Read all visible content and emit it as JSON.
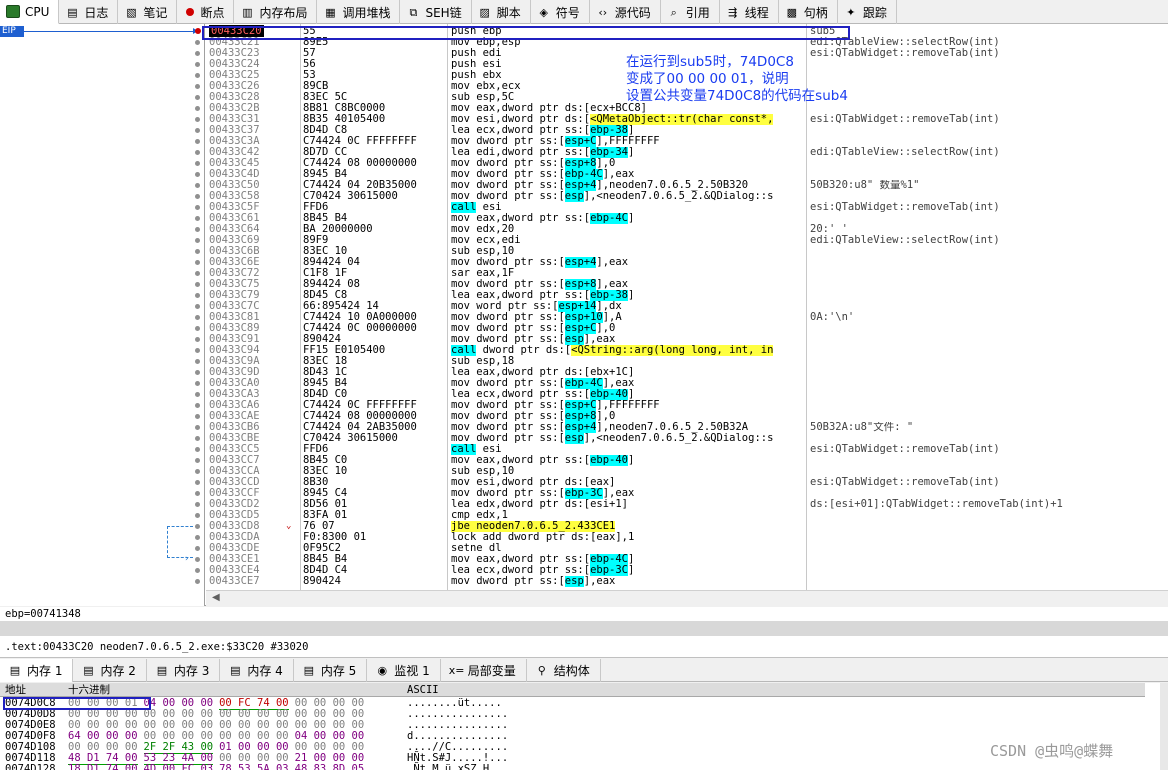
{
  "top_tabs": [
    {
      "icon": "cpu-icon",
      "label": "CPU"
    },
    {
      "icon": "log-icon",
      "label": "日志"
    },
    {
      "icon": "notes-icon",
      "label": "笔记"
    },
    {
      "icon": "breakpoint-icon",
      "label": "断点"
    },
    {
      "icon": "memory-map-icon",
      "label": "内存布局"
    },
    {
      "icon": "callstack-icon",
      "label": "调用堆栈"
    },
    {
      "icon": "seh-icon",
      "label": "SEH链"
    },
    {
      "icon": "script-icon",
      "label": "脚本"
    },
    {
      "icon": "symbols-icon",
      "label": "符号"
    },
    {
      "icon": "source-icon",
      "label": "源代码"
    },
    {
      "icon": "references-icon",
      "label": "引用"
    },
    {
      "icon": "threads-icon",
      "label": "线程"
    },
    {
      "icon": "handles-icon",
      "label": "句柄"
    },
    {
      "icon": "trace-icon",
      "label": "跟踪"
    }
  ],
  "eip_label": "EIP",
  "annotation": [
    "在运行到sub5时，74D0C8",
    "变成了00 00 00 01，说明",
    "设置公共变量74D0C8的代码在sub4"
  ],
  "dis_rows": [
    {
      "addr": "00433C20",
      "bytes": "55",
      "instr": "push ebp",
      "cmt": "sub5"
    },
    {
      "addr": "00433C21",
      "bytes": "89E5",
      "instr": "mov ebp,esp",
      "cmt": "edi:QTableView::selectRow(int)"
    },
    {
      "addr": "00433C23",
      "bytes": "57",
      "instr": "push edi",
      "cmt": "esi:QTabWidget::removeTab(int)"
    },
    {
      "addr": "00433C24",
      "bytes": "56",
      "instr": "push esi",
      "cmt": ""
    },
    {
      "addr": "00433C25",
      "bytes": "53",
      "instr": "push ebx",
      "cmt": ""
    },
    {
      "addr": "00433C26",
      "bytes": "89CB",
      "instr": "mov ebx,ecx",
      "cmt": ""
    },
    {
      "addr": "00433C28",
      "bytes": "83EC 5C",
      "instr": "sub esp,5C",
      "cmt": ""
    },
    {
      "addr": "00433C2B",
      "bytes": "8B81 C8BC0000",
      "instr": "mov eax,dword ptr ds:[ecx+BCC8]",
      "cmt": ""
    },
    {
      "addr": "00433C31",
      "bytes": "8B35 40105400",
      "instr": "mov esi,dword ptr ds:[<QMetaObject::tr(char const*,",
      "cmt": "esi:QTabWidget::removeTab(int)"
    },
    {
      "addr": "00433C37",
      "bytes": "8D4D C8",
      "instr": "lea ecx,dword ptr ss:[ebp-38]",
      "cmt": ""
    },
    {
      "addr": "00433C3A",
      "bytes": "C74424 0C FFFFFFFF",
      "instr": "mov dword ptr ss:[esp+C],FFFFFFFF",
      "cmt": ""
    },
    {
      "addr": "00433C42",
      "bytes": "8D7D CC",
      "instr": "lea edi,dword ptr ss:[ebp-34]",
      "cmt": "edi:QTableView::selectRow(int)"
    },
    {
      "addr": "00433C45",
      "bytes": "C74424 08 00000000",
      "instr": "mov dword ptr ss:[esp+8],0",
      "cmt": ""
    },
    {
      "addr": "00433C4D",
      "bytes": "8945 B4",
      "instr": "mov dword ptr ss:[ebp-4C],eax",
      "cmt": ""
    },
    {
      "addr": "00433C50",
      "bytes": "C74424 04 20B35000",
      "instr": "mov dword ptr ss:[esp+4],neoden7.0.6.5_2.50B320",
      "cmt": "50B320:u8\" 数量%1\""
    },
    {
      "addr": "00433C58",
      "bytes": "C70424 30615000",
      "instr": "mov dword ptr ss:[esp],<neoden7.0.6.5_2.&QDialog::s",
      "cmt": ""
    },
    {
      "addr": "00433C5F",
      "bytes": "FFD6",
      "instr": "call esi",
      "cmt": "esi:QTabWidget::removeTab(int)"
    },
    {
      "addr": "00433C61",
      "bytes": "8B45 B4",
      "instr": "mov eax,dword ptr ss:[ebp-4C]",
      "cmt": ""
    },
    {
      "addr": "00433C64",
      "bytes": "BA 20000000",
      "instr": "mov edx,20",
      "cmt": "20:' '"
    },
    {
      "addr": "00433C69",
      "bytes": "89F9",
      "instr": "mov ecx,edi",
      "cmt": "edi:QTableView::selectRow(int)"
    },
    {
      "addr": "00433C6B",
      "bytes": "83EC 10",
      "instr": "sub esp,10",
      "cmt": ""
    },
    {
      "addr": "00433C6E",
      "bytes": "894424 04",
      "instr": "mov dword ptr ss:[esp+4],eax",
      "cmt": ""
    },
    {
      "addr": "00433C72",
      "bytes": "C1F8 1F",
      "instr": "sar eax,1F",
      "cmt": ""
    },
    {
      "addr": "00433C75",
      "bytes": "894424 08",
      "instr": "mov dword ptr ss:[esp+8],eax",
      "cmt": ""
    },
    {
      "addr": "00433C79",
      "bytes": "8D45 C8",
      "instr": "lea eax,dword ptr ss:[ebp-38]",
      "cmt": ""
    },
    {
      "addr": "00433C7C",
      "bytes": "66:895424 14",
      "instr": "mov word ptr ss:[esp+14],dx",
      "cmt": ""
    },
    {
      "addr": "00433C81",
      "bytes": "C74424 10 0A000000",
      "instr": "mov dword ptr ss:[esp+10],A",
      "cmt": "0A:'\\n'"
    },
    {
      "addr": "00433C89",
      "bytes": "C74424 0C 00000000",
      "instr": "mov dword ptr ss:[esp+C],0",
      "cmt": ""
    },
    {
      "addr": "00433C91",
      "bytes": "890424",
      "instr": "mov dword ptr ss:[esp],eax",
      "cmt": ""
    },
    {
      "addr": "00433C94",
      "bytes": "FF15 E0105400",
      "instr": "call dword ptr ds:[<QString::arg(long long, int, in",
      "cmt": ""
    },
    {
      "addr": "00433C9A",
      "bytes": "83EC 18",
      "instr": "sub esp,18",
      "cmt": ""
    },
    {
      "addr": "00433C9D",
      "bytes": "8D43 1C",
      "instr": "lea eax,dword ptr ds:[ebx+1C]",
      "cmt": ""
    },
    {
      "addr": "00433CA0",
      "bytes": "8945 B4",
      "instr": "mov dword ptr ss:[ebp-4C],eax",
      "cmt": ""
    },
    {
      "addr": "00433CA3",
      "bytes": "8D4D C0",
      "instr": "lea ecx,dword ptr ss:[ebp-40]",
      "cmt": ""
    },
    {
      "addr": "00433CA6",
      "bytes": "C74424 0C FFFFFFFF",
      "instr": "mov dword ptr ss:[esp+C],FFFFFFFF",
      "cmt": ""
    },
    {
      "addr": "00433CAE",
      "bytes": "C74424 08 00000000",
      "instr": "mov dword ptr ss:[esp+8],0",
      "cmt": ""
    },
    {
      "addr": "00433CB6",
      "bytes": "C74424 04 2AB35000",
      "instr": "mov dword ptr ss:[esp+4],neoden7.0.6.5_2.50B32A",
      "cmt": "50B32A:u8\"文件: \""
    },
    {
      "addr": "00433CBE",
      "bytes": "C70424 30615000",
      "instr": "mov dword ptr ss:[esp],<neoden7.0.6.5_2.&QDialog::s",
      "cmt": ""
    },
    {
      "addr": "00433CC5",
      "bytes": "FFD6",
      "instr": "call esi",
      "cmt": "esi:QTabWidget::removeTab(int)"
    },
    {
      "addr": "00433CC7",
      "bytes": "8B45 C0",
      "instr": "mov eax,dword ptr ss:[ebp-40]",
      "cmt": ""
    },
    {
      "addr": "00433CCA",
      "bytes": "83EC 10",
      "instr": "sub esp,10",
      "cmt": ""
    },
    {
      "addr": "00433CCD",
      "bytes": "8B30",
      "instr": "mov esi,dword ptr ds:[eax]",
      "cmt": "esi:QTabWidget::removeTab(int)"
    },
    {
      "addr": "00433CCF",
      "bytes": "8945 C4",
      "instr": "mov dword ptr ss:[ebp-3C],eax",
      "cmt": ""
    },
    {
      "addr": "00433CD2",
      "bytes": "8D56 01",
      "instr": "lea edx,dword ptr ds:[esi+1]",
      "cmt": "ds:[esi+01]:QTabWidget::removeTab(int)+1"
    },
    {
      "addr": "00433CD5",
      "bytes": "83FA 01",
      "instr": "cmp edx,1",
      "cmt": ""
    },
    {
      "addr": "00433CD8",
      "bytes": "76 07",
      "instr": "jbe neoden7.0.6.5_2.433CE1",
      "cmt": ""
    },
    {
      "addr": "00433CDA",
      "bytes": "F0:8300 01",
      "instr": "lock add dword ptr ds:[eax],1",
      "cmt": ""
    },
    {
      "addr": "00433CDE",
      "bytes": "0F95C2",
      "instr": "setne dl",
      "cmt": ""
    },
    {
      "addr": "00433CE1",
      "bytes": "8B45 B4",
      "instr": "mov eax,dword ptr ss:[ebp-4C]",
      "cmt": ""
    },
    {
      "addr": "00433CE4",
      "bytes": "8D4D C4",
      "instr": "lea ecx,dword ptr ss:[ebp-3C]",
      "cmt": ""
    },
    {
      "addr": "00433CE7",
      "bytes": "890424",
      "instr": "mov dword ptr ss:[esp],eax",
      "cmt": ""
    }
  ],
  "info_line1": "ebp=00741348",
  "info_line2": ".text:00433C20 neoden7.0.6.5_2.exe:$33C20 #33020",
  "bottom_tabs": [
    {
      "icon": "memory-icon",
      "label": "内存 1"
    },
    {
      "icon": "memory-icon",
      "label": "内存 2"
    },
    {
      "icon": "memory-icon",
      "label": "内存 3"
    },
    {
      "icon": "memory-icon",
      "label": "内存 4"
    },
    {
      "icon": "memory-icon",
      "label": "内存 5"
    },
    {
      "icon": "watch-icon",
      "label": "监视 1"
    },
    {
      "icon": "locals-icon",
      "label": "局部变量"
    },
    {
      "icon": "struct-icon",
      "label": "结构体"
    }
  ],
  "dump_headers": {
    "addr": "地址",
    "hex": "十六进制",
    "ascii": "ASCII"
  },
  "dump_rows": [
    {
      "addr": "0074D0C8",
      "hex": [
        "00 00 00 01",
        "04 00 00 00",
        "00 FC 74 00",
        "00 00 00 00"
      ],
      "ascii": "........üt....."
    },
    {
      "addr": "0074D0D8",
      "hex": [
        "00 00 00 00",
        "00 00 00 00",
        "00 00 00 00",
        "00 00 00 00"
      ],
      "ascii": "................"
    },
    {
      "addr": "0074D0E8",
      "hex": [
        "00 00 00 00",
        "00 00 00 00",
        "00 00 00 00",
        "00 00 00 00"
      ],
      "ascii": "................"
    },
    {
      "addr": "0074D0F8",
      "hex": [
        "64 00 00 00",
        "00 00 00 00",
        "00 00 00 00",
        "04 00 00 00"
      ],
      "ascii": "d..............."
    },
    {
      "addr": "0074D108",
      "hex": [
        "00 00 00 00",
        "2F 2F 43 00",
        "01 00 00 00",
        "00 00 00 00"
      ],
      "ascii": "....//C........."
    },
    {
      "addr": "0074D118",
      "hex": [
        "48 D1 74 00",
        "53 23 4A 00",
        "00 00 00 00",
        "21 00 00 00"
      ],
      "ascii": "HÑt.S#J.....!..."
    },
    {
      "addr": "0074D128",
      "hex": [
        "18 D1 74 00",
        "4D 00 FC 03",
        "78 53 5A 03",
        "48 83 8D 05"
      ],
      "ascii": ".Ñt.M.ü.xSZ.H..."
    }
  ],
  "watermark": "CSDN @虫鸣@蝶舞"
}
